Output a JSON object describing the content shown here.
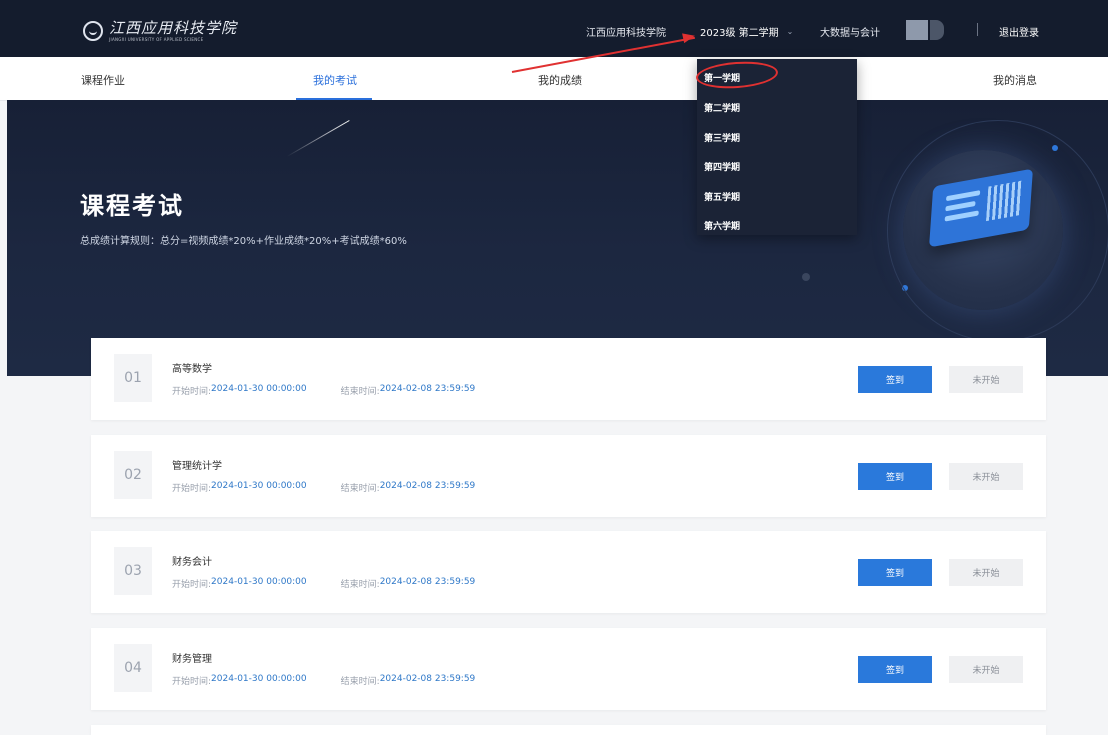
{
  "header": {
    "logo_text": "江西应用科技学院",
    "logo_subtext": "JIANGXI UNIVERSITY OF APPLIED SCIENCE",
    "school": "江西应用科技学院",
    "term": "2023级 第二学期",
    "major": "大数据与会计",
    "logout": "退出登录"
  },
  "nav": {
    "items": [
      "课程作业",
      "我的考试",
      "我的成绩",
      "我的消息"
    ],
    "active": "我的考试"
  },
  "term_dropdown": {
    "options": [
      "第一学期",
      "第二学期",
      "第三学期",
      "第四学期",
      "第五学期",
      "第六学期"
    ],
    "highlighted": "第一学期"
  },
  "hero": {
    "title": "课程考试",
    "rule": "总成绩计算规则：总分=视频成绩*20%+作业成绩*20%+考试成绩*60%"
  },
  "labels": {
    "start": "开始时间:",
    "end": "结束时间:",
    "signin": "签到",
    "status": "未开始"
  },
  "exams": [
    {
      "index": "01",
      "name": "高等数学",
      "start": "2024-01-30 00:00:00",
      "end": "2024-02-08 23:59:59"
    },
    {
      "index": "02",
      "name": "管理统计学",
      "start": "2024-01-30 00:00:00",
      "end": "2024-02-08 23:59:59"
    },
    {
      "index": "03",
      "name": "财务会计",
      "start": "2024-01-30 00:00:00",
      "end": "2024-02-08 23:59:59"
    },
    {
      "index": "04",
      "name": "财务管理",
      "start": "2024-01-30 00:00:00",
      "end": "2024-02-08 23:59:59"
    }
  ],
  "colors": {
    "header_bg": "#141c2d",
    "accent": "#2a79db",
    "annotation": "#e03131"
  }
}
